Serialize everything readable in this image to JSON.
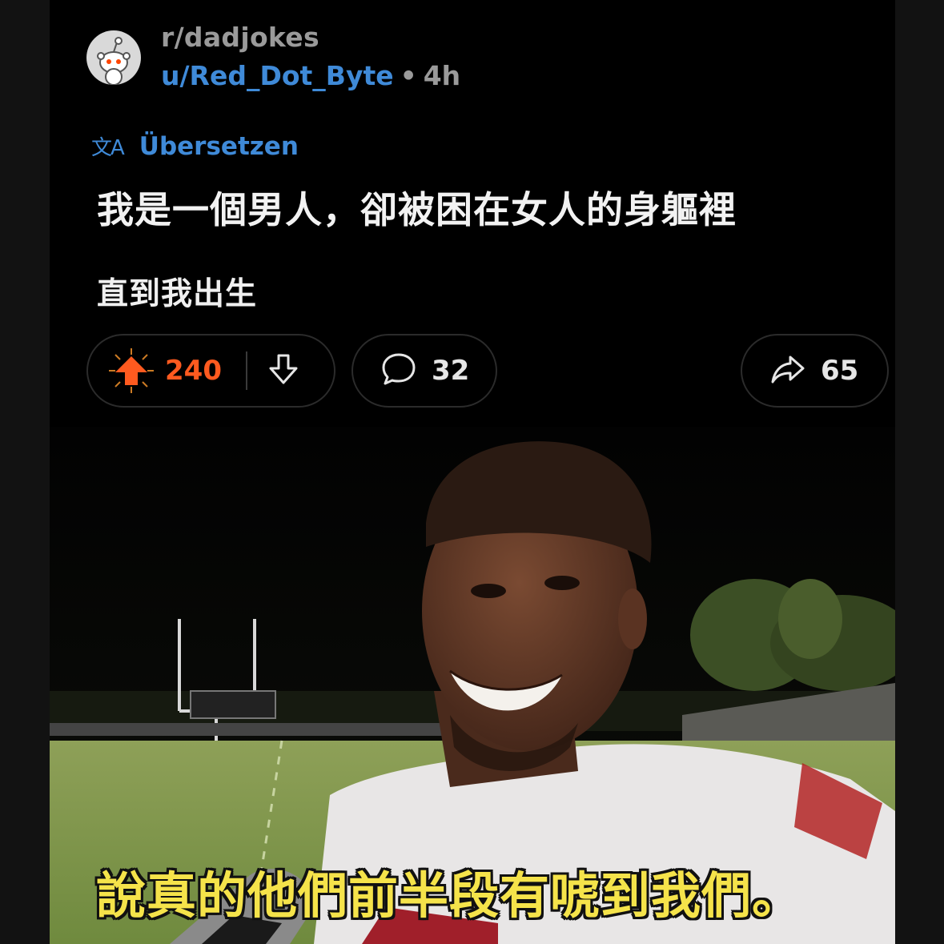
{
  "post": {
    "subreddit": "r/dadjokes",
    "username": "u/Red_Dot_Byte",
    "separator": "•",
    "age": "4h",
    "translate_icon": "文A",
    "translate_label": "Übersetzen",
    "title": "我是一個男人，卻被困在女人的身軀裡",
    "body": "直到我出生"
  },
  "actions": {
    "upvotes": "240",
    "comments": "32",
    "shares": "65",
    "upvote_color": "#ff5a1f",
    "icons": [
      "upvote-arrow-icon",
      "downvote-arrow-icon",
      "comment-bubble-icon",
      "share-arrow-icon"
    ]
  },
  "media": {
    "subtitle": "說真的他們前半段有唬到我們。",
    "subtitle_color": "#f5e34a"
  },
  "colors": {
    "background": "#000000",
    "link_blue": "#3f8ad8",
    "muted_text": "#9a9a9a"
  }
}
